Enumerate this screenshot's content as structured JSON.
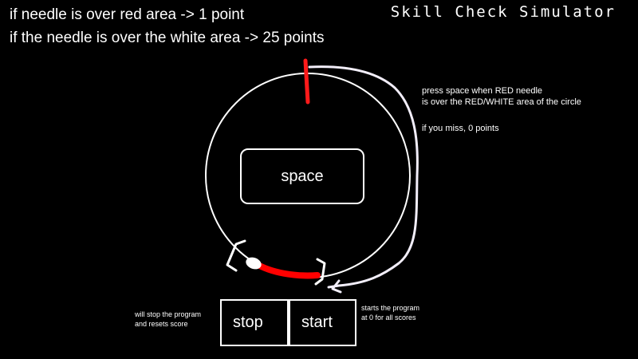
{
  "header": {
    "title": "Skill Check Simulator",
    "rules": [
      "if needle is over red area -> 1 point",
      "if the needle is over the white area -> 25 points"
    ]
  },
  "instructions": [
    "press space when RED needle",
    "is over the RED/WHITE area of the circle",
    "if you miss, 0 points"
  ],
  "space_button": {
    "label": "space"
  },
  "controls": {
    "stop_label": "stop",
    "start_label": "start",
    "stop_note": [
      "will stop the program",
      "and resets score"
    ],
    "start_note": [
      "starts the program",
      "at 0 for all scores"
    ]
  },
  "colors": {
    "background": "#000000",
    "foreground": "#ffffff",
    "needle": "#ff1a1a",
    "red_zone": "#ff0000",
    "white_zone": "#ffffff",
    "annotation": "#f2eefa"
  }
}
